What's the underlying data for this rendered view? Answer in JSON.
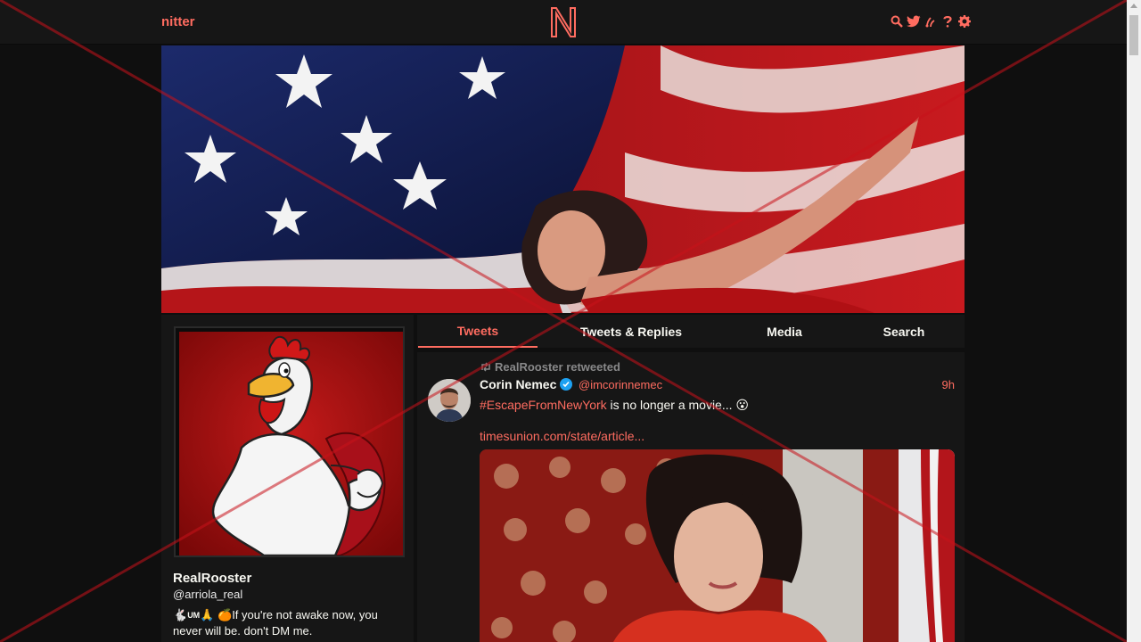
{
  "navbar": {
    "brand": "nitter",
    "logo_letter": "N",
    "icons": [
      "search-icon",
      "twitter-bird-icon",
      "rss-icon",
      "help-icon",
      "gear-icon"
    ]
  },
  "profile": {
    "fullname": "RealRooster",
    "username": "@arriola_real",
    "bio_prefix": "🐇",
    "bio_um": "UM",
    "bio_emoji": "🙏  🍊",
    "bio_text": "If you're not awake now, you never will be. don't DM me."
  },
  "tabs": [
    {
      "label": "Tweets",
      "active": true
    },
    {
      "label": "Tweets & Replies",
      "active": false
    },
    {
      "label": "Media",
      "active": false
    },
    {
      "label": "Search",
      "active": false
    }
  ],
  "tweet": {
    "retweet_header": "RealRooster retweeted",
    "fullname": "Corin Nemec",
    "username": "@imcorinnemec",
    "date": "9h",
    "hashtag": "#EscapeFromNewYork",
    "text": " is no longer a movie... 😮",
    "link": "timesunion.com/state/article..."
  },
  "colors": {
    "accent": "#ff6c60",
    "background": "#0f0f0f",
    "panel": "#161616",
    "text": "#f8f8f2",
    "muted": "#888889",
    "overlay_x": "#c8121a"
  }
}
